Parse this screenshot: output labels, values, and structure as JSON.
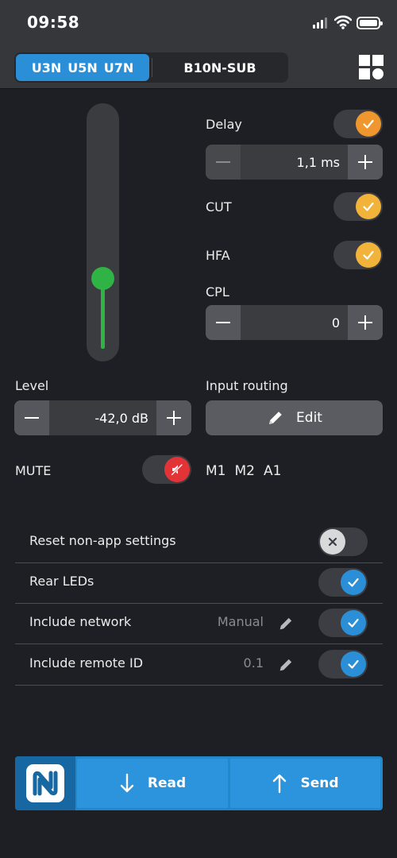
{
  "status_bar": {
    "time": "09:58"
  },
  "header": {
    "device_tab_active": {
      "labels": [
        "U3N",
        "U5N",
        "U7N"
      ]
    },
    "device_tab_other": {
      "label": "B10N-SUB"
    },
    "menu_icon": "grid-icon"
  },
  "fader": {
    "level_fraction": 0.28,
    "color": "#2fb344"
  },
  "delay": {
    "label": "Delay",
    "enabled": true,
    "value": "1,1 ms",
    "color": "#f0962f"
  },
  "cut": {
    "label": "CUT",
    "enabled": true,
    "color": "#f2b33a"
  },
  "hfa": {
    "label": "HFA",
    "enabled": true,
    "color": "#f2b33a"
  },
  "cpl": {
    "label": "CPL",
    "value": "0"
  },
  "level": {
    "label": "Level",
    "value": "-42,0 dB"
  },
  "input_routing": {
    "label": "Input routing",
    "edit_label": "Edit",
    "inputs": [
      "M1",
      "M2",
      "A1"
    ]
  },
  "mute": {
    "label": "MUTE",
    "active": true,
    "color": "#e23437"
  },
  "settings": [
    {
      "label": "Reset non-app settings",
      "extra": "",
      "enabled": false
    },
    {
      "label": "Rear LEDs",
      "extra": "",
      "enabled": true
    },
    {
      "label": "Include network",
      "extra": "Manual",
      "enabled": true
    },
    {
      "label": "Include remote ID",
      "extra": "0.1",
      "enabled": true
    }
  ],
  "bottom_bar": {
    "read_label": "Read",
    "send_label": "Send"
  },
  "colors": {
    "accent": "#2a8fd6",
    "background": "#1d1f24",
    "panel": "#35373b"
  }
}
